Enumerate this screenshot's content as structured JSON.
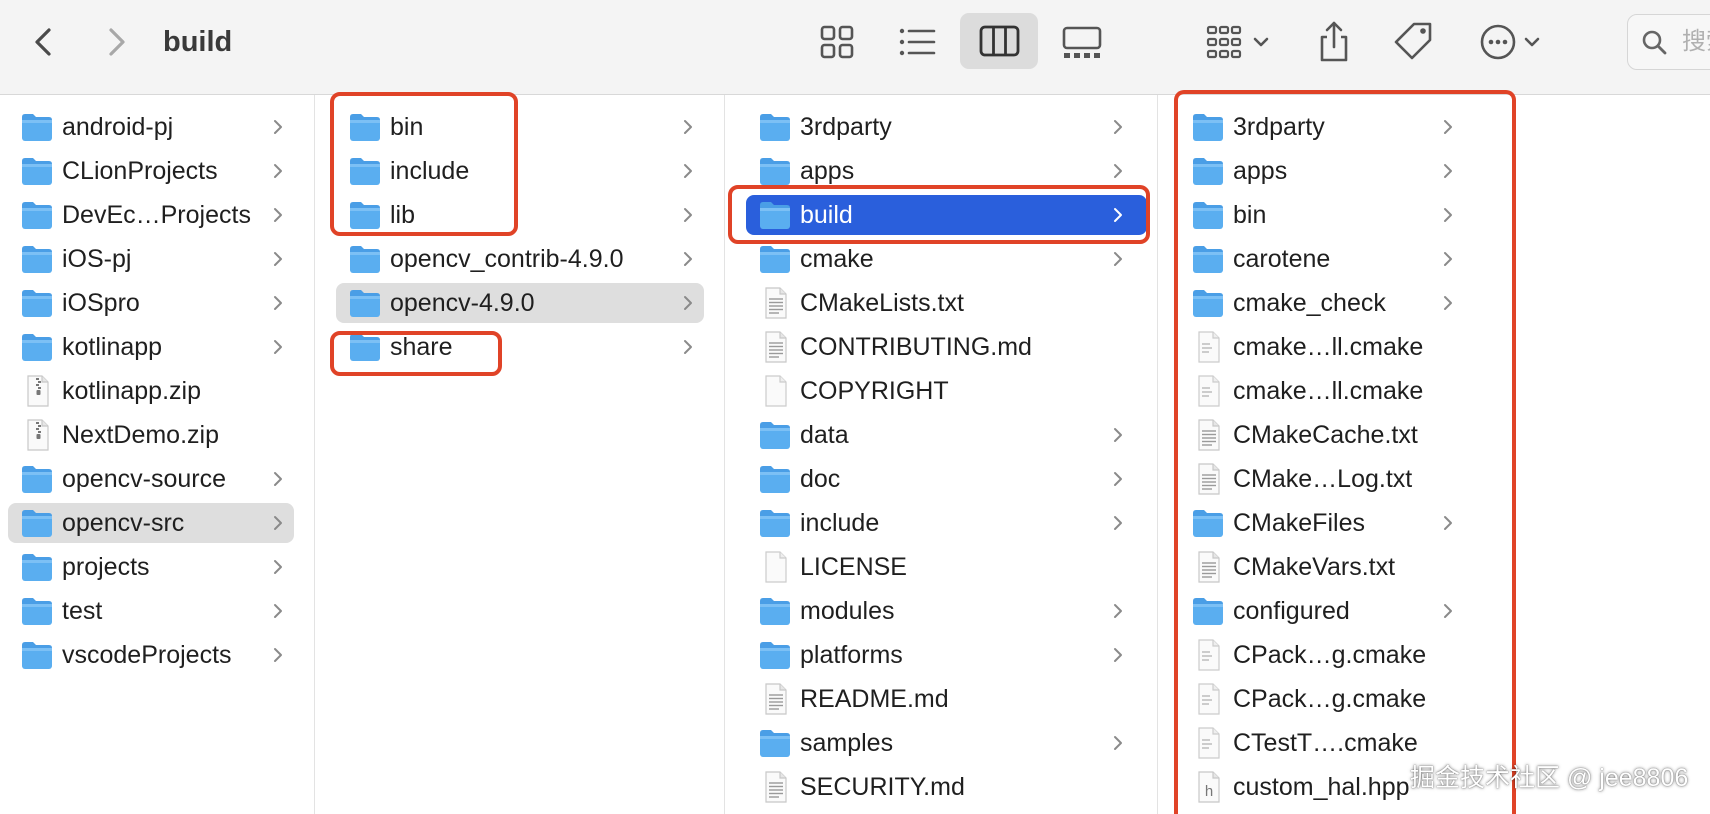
{
  "toolbar": {
    "title": "build",
    "search_placeholder": "搜索"
  },
  "colors": {
    "folder": "#5aaef0",
    "selection_active": "#2a5fdc",
    "selection_inactive": "#dedede",
    "annotation": "#e04327"
  },
  "columns": [
    {
      "items": [
        {
          "name": "android-pj",
          "icon": "folder-icon",
          "chevron": true
        },
        {
          "name": "CLionProjects",
          "icon": "folder-icon",
          "chevron": true
        },
        {
          "name": "DevEc…Projects",
          "icon": "folder-icon",
          "chevron": true
        },
        {
          "name": "iOS-pj",
          "icon": "folder-icon",
          "chevron": true
        },
        {
          "name": "iOSpro",
          "icon": "folder-icon",
          "chevron": true
        },
        {
          "name": "kotlinapp",
          "icon": "folder-icon",
          "chevron": true
        },
        {
          "name": "kotlinapp.zip",
          "icon": "zip-icon",
          "chevron": false
        },
        {
          "name": "NextDemo.zip",
          "icon": "zip-icon",
          "chevron": false
        },
        {
          "name": "opencv-source",
          "icon": "folder-icon",
          "chevron": true
        },
        {
          "name": "opencv-src",
          "icon": "folder-icon",
          "chevron": true,
          "selected": "inactive"
        },
        {
          "name": "projects",
          "icon": "folder-icon",
          "chevron": true
        },
        {
          "name": "test",
          "icon": "folder-icon",
          "chevron": true
        },
        {
          "name": "vscodeProjects",
          "icon": "folder-icon",
          "chevron": true
        }
      ]
    },
    {
      "items": [
        {
          "name": "bin",
          "icon": "folder-icon",
          "chevron": true
        },
        {
          "name": "include",
          "icon": "folder-icon",
          "chevron": true
        },
        {
          "name": "lib",
          "icon": "folder-icon",
          "chevron": true
        },
        {
          "name": "opencv_contrib-4.9.0",
          "icon": "folder-icon",
          "chevron": true
        },
        {
          "name": "opencv-4.9.0",
          "icon": "folder-icon",
          "chevron": true,
          "selected": "inactive"
        },
        {
          "name": "share",
          "icon": "folder-icon",
          "chevron": true
        }
      ]
    },
    {
      "items": [
        {
          "name": "3rdparty",
          "icon": "folder-icon",
          "chevron": true
        },
        {
          "name": "apps",
          "icon": "folder-icon",
          "chevron": true
        },
        {
          "name": "build",
          "icon": "folder-icon",
          "chevron": true,
          "selected": "active"
        },
        {
          "name": "cmake",
          "icon": "folder-icon",
          "chevron": true
        },
        {
          "name": "CMakeLists.txt",
          "icon": "text-file-icon",
          "chevron": false
        },
        {
          "name": "CONTRIBUTING.md",
          "icon": "text-file-icon",
          "chevron": false
        },
        {
          "name": "COPYRIGHT",
          "icon": "blank-file-icon",
          "chevron": false
        },
        {
          "name": "data",
          "icon": "folder-icon",
          "chevron": true
        },
        {
          "name": "doc",
          "icon": "folder-icon",
          "chevron": true
        },
        {
          "name": "include",
          "icon": "folder-icon",
          "chevron": true
        },
        {
          "name": "LICENSE",
          "icon": "blank-file-icon",
          "chevron": false
        },
        {
          "name": "modules",
          "icon": "folder-icon",
          "chevron": true
        },
        {
          "name": "platforms",
          "icon": "folder-icon",
          "chevron": true
        },
        {
          "name": "README.md",
          "icon": "text-file-icon",
          "chevron": false
        },
        {
          "name": "samples",
          "icon": "folder-icon",
          "chevron": true
        },
        {
          "name": "SECURITY.md",
          "icon": "text-file-icon",
          "chevron": false
        }
      ]
    },
    {
      "items": [
        {
          "name": "3rdparty",
          "icon": "folder-icon",
          "chevron": true
        },
        {
          "name": "apps",
          "icon": "folder-icon",
          "chevron": true
        },
        {
          "name": "bin",
          "icon": "folder-icon",
          "chevron": true
        },
        {
          "name": "carotene",
          "icon": "folder-icon",
          "chevron": true
        },
        {
          "name": "cmake_check",
          "icon": "folder-icon",
          "chevron": true
        },
        {
          "name": "cmake…ll.cmake",
          "icon": "doc-file-icon",
          "chevron": false
        },
        {
          "name": "cmake…ll.cmake",
          "icon": "doc-file-icon",
          "chevron": false
        },
        {
          "name": "CMakeCache.txt",
          "icon": "text-file-icon",
          "chevron": false
        },
        {
          "name": "CMake…Log.txt",
          "icon": "text-file-icon",
          "chevron": false
        },
        {
          "name": "CMakeFiles",
          "icon": "folder-icon",
          "chevron": true
        },
        {
          "name": "CMakeVars.txt",
          "icon": "text-file-icon",
          "chevron": false
        },
        {
          "name": "configured",
          "icon": "folder-icon",
          "chevron": true
        },
        {
          "name": "CPack…g.cmake",
          "icon": "doc-file-icon",
          "chevron": false
        },
        {
          "name": "CPack…g.cmake",
          "icon": "doc-file-icon",
          "chevron": false
        },
        {
          "name": "CTestT….cmake",
          "icon": "doc-file-icon",
          "chevron": false
        },
        {
          "name": "custom_hal.hpp",
          "icon": "header-file-icon",
          "chevron": false,
          "icon_letter": "h"
        }
      ]
    }
  ],
  "watermark": "掘金技术社区 @ jee8806"
}
